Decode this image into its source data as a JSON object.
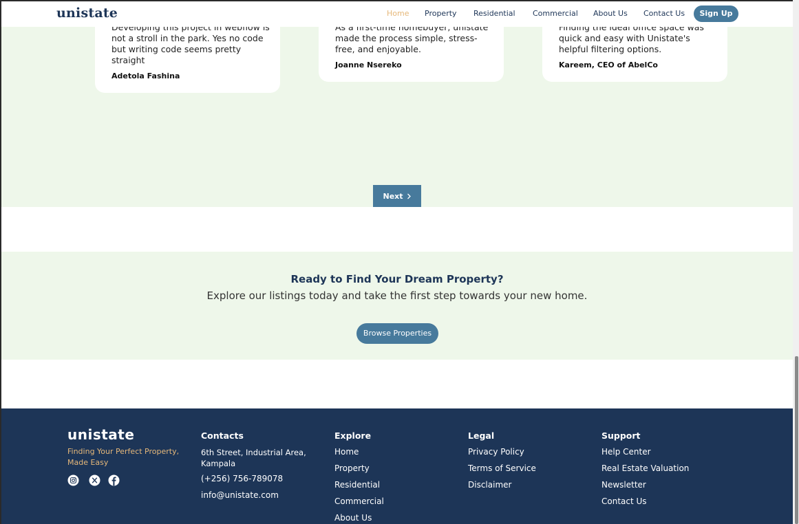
{
  "header": {
    "logo": "unistate",
    "nav": [
      "Home",
      "Property",
      "Residential",
      "Commercial",
      "About Us",
      "Contact Us"
    ],
    "active": "Home",
    "signup_label": "Sign Up"
  },
  "testimonials": [
    {
      "quote_lines": [
        "Developing this project in webflow is",
        "not a stroll in the park. Yes no code",
        "but writing code seems pretty",
        "straight"
      ],
      "author": "Adetola Fashina"
    },
    {
      "quote_lines": [
        "As a first-time homebuyer, unistate",
        "made the process simple, stress-",
        "free, and enjoyable."
      ],
      "author": "Joanne Nsereko"
    },
    {
      "quote_lines": [
        "Finding the ideal office space was",
        "quick and easy with Unistate's",
        "helpful filtering options."
      ],
      "author": "Kareem, CEO of AbelCo"
    }
  ],
  "pagination": {
    "next_label": "Next"
  },
  "cta": {
    "title": "Ready to Find Your Dream Property?",
    "subtitle": "Explore our listings today and take the first step towards your new home.",
    "button_label": "Browse Properties"
  },
  "footer": {
    "logo": "unistate",
    "tagline_lines": [
      "Finding Your Perfect Property,",
      "Made Easy"
    ],
    "social_icons": [
      "instagram-icon",
      "x-icon",
      "facebook-icon"
    ],
    "contacts": {
      "heading": "Contacts",
      "address_lines": [
        "6th Street, Industrial Area,",
        "Kampala"
      ],
      "phone": "(+256) 756-789078",
      "email": "info@unistate.com"
    },
    "explore": {
      "heading": "Explore",
      "links": [
        "Home",
        "Property",
        "Residential",
        "Commercial",
        "About Us"
      ]
    },
    "legal": {
      "heading": "Legal",
      "links": [
        "Privacy Policy",
        "Terms of Service",
        "Disclaimer"
      ]
    },
    "support": {
      "heading": "Support",
      "links": [
        "Help Center",
        "Real Estate Valuation",
        "Newsletter",
        "Contact Us"
      ]
    }
  },
  "colors": {
    "brand_navy": "#1d3557",
    "accent_blue": "#477a9c",
    "accent_gold": "#e6b87a",
    "section_green": "#eef7ea"
  }
}
